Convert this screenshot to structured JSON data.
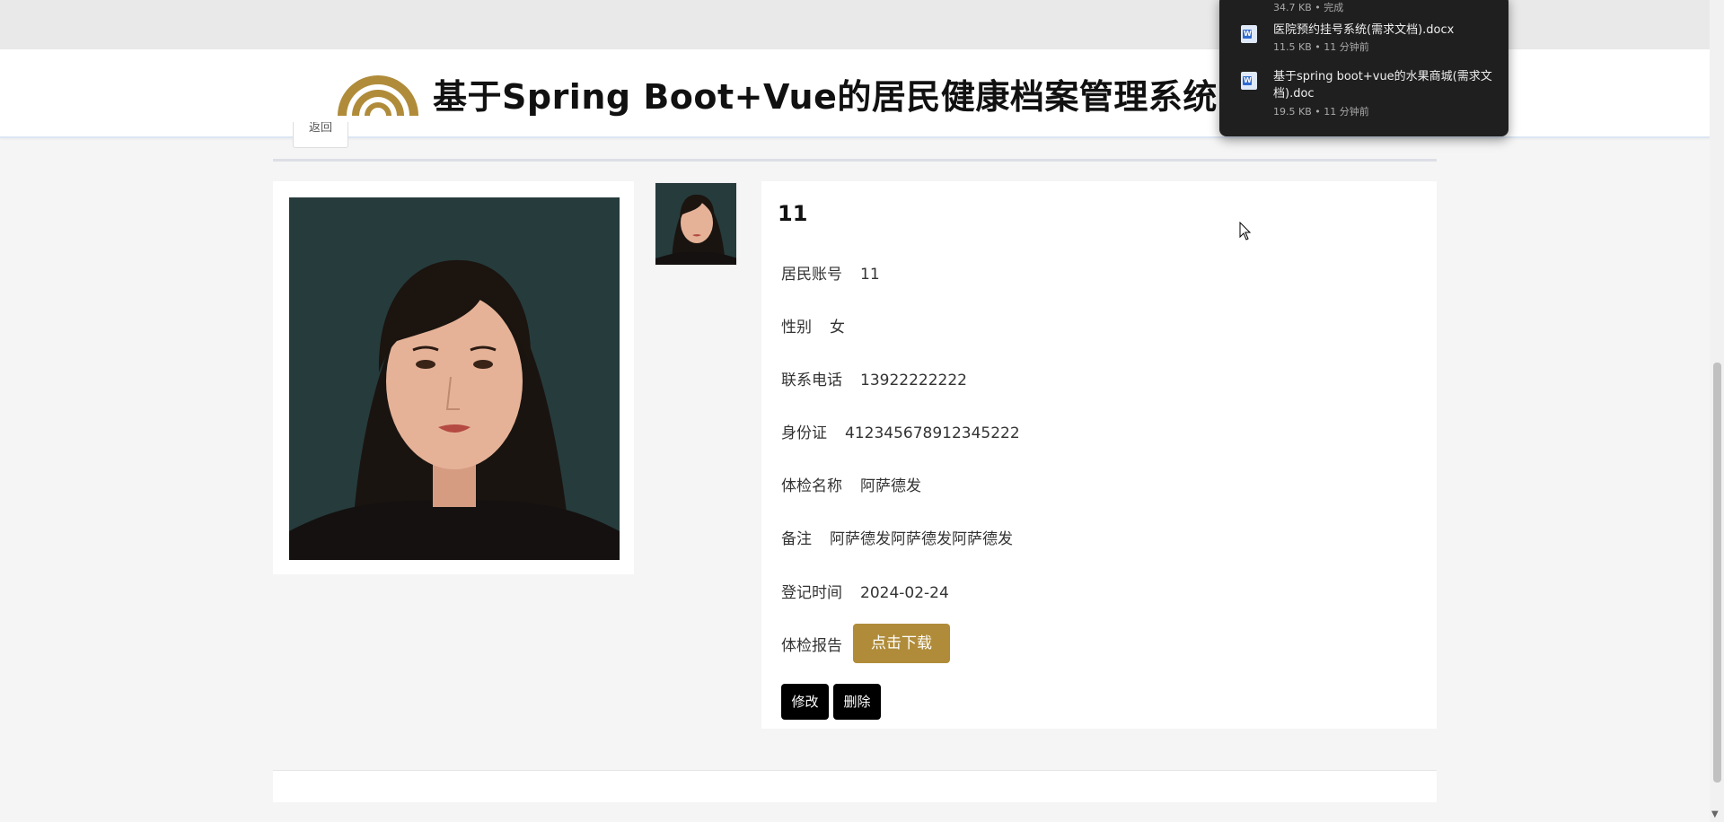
{
  "header": {
    "title": "基于Spring Boot+Vue的居民健康档案管理系统",
    "logo_color": "#b08c3a"
  },
  "back_button": {
    "label": "返回"
  },
  "resident": {
    "name": "11",
    "fields": [
      {
        "label": "居民账号",
        "value": "11"
      },
      {
        "label": "性别",
        "value": "女"
      },
      {
        "label": "联系电话",
        "value": "13922222222"
      },
      {
        "label": "身份证",
        "value": "412345678912345222"
      },
      {
        "label": "体检名称",
        "value": "阿萨德发"
      },
      {
        "label": "备注",
        "value": "阿萨德发阿萨德发阿萨德发"
      },
      {
        "label": "登记时间",
        "value": "2024-02-24"
      }
    ],
    "report_label": "体检报告",
    "download_label": "点击下载"
  },
  "actions": {
    "edit_label": "修改",
    "delete_label": "删除"
  },
  "downloads": {
    "top_status": "34.7 KB • 完成",
    "items": [
      {
        "name": "医院预约挂号系统(需求文档).docx",
        "meta": "11.5 KB • 11 分钟前",
        "icon": "word-file-icon"
      },
      {
        "name": "基于spring boot+vue的水果商城(需求文档).doc",
        "meta": "19.5 KB • 11 分钟前",
        "icon": "word-file-icon"
      }
    ]
  },
  "colors": {
    "accent": "#b08c3a",
    "action_button": "#000000"
  }
}
